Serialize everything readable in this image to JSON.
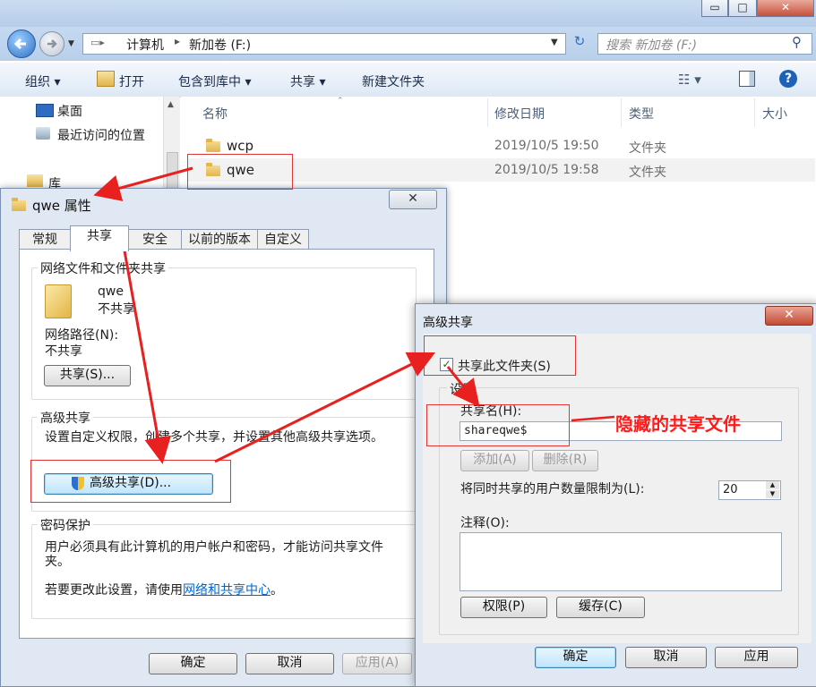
{
  "window": {
    "minimize": "▭",
    "maximize": "□",
    "close": "✕"
  },
  "address": {
    "crumb1": "计算机",
    "crumb2": "新加卷 (F:)"
  },
  "search": {
    "placeholder": "搜索 新加卷 (F:)"
  },
  "toolbar": {
    "organize": "组织 ▾",
    "open": "打开",
    "include": "包含到库中 ▾",
    "share": "共享 ▾",
    "new_folder": "新建文件夹"
  },
  "nav": {
    "desktop": "桌面",
    "recent": "最近访问的位置",
    "library": "库"
  },
  "columns": {
    "name": "名称",
    "modified": "修改日期",
    "type": "类型",
    "size": "大小"
  },
  "files": [
    {
      "name": "wcp",
      "modified": "2019/10/5 19:50",
      "type": "文件夹"
    },
    {
      "name": "qwe",
      "modified": "2019/10/5 19:58",
      "type": "文件夹"
    }
  ],
  "props": {
    "title": "qwe 属性",
    "tabs": [
      "常规",
      "共享",
      "安全",
      "以前的版本",
      "自定义"
    ],
    "net_group": "网络文件和文件夹共享",
    "folder_name": "qwe",
    "folder_status": "不共享",
    "net_path_label": "网络路径(N):",
    "net_path_value": "不共享",
    "share_button": "共享(S)...",
    "adv_group": "高级共享",
    "adv_desc": "设置自定义权限，创建多个共享，并设置其他高级共享选项。",
    "adv_button": "高级共享(D)...",
    "pwd_group": "密码保护",
    "pwd_desc": "用户必须具有此计算机的用户帐户和密码，才能访问共享文件夹。",
    "pwd_change_prefix": "若要更改此设置，请使用",
    "pwd_link": "网络和共享中心",
    "pwd_change_suffix": "。",
    "ok": "确定",
    "cancel": "取消",
    "apply": "应用(A)"
  },
  "adv": {
    "title": "高级共享",
    "share_checkbox": "共享此文件夹(S)",
    "settings_group": "设置",
    "share_name_label": "共享名(H):",
    "share_name_value": "shareqwe$",
    "add": "添加(A)",
    "remove": "删除(R)",
    "limit_label": "将同时共享的用户数量限制为(L):",
    "limit_value": "20",
    "comment_label": "注释(O):",
    "permissions": "权限(P)",
    "caching": "缓存(C)",
    "ok": "确定",
    "cancel": "取消",
    "apply": "应用"
  },
  "annotation": {
    "text": "隐藏的共享文件"
  }
}
